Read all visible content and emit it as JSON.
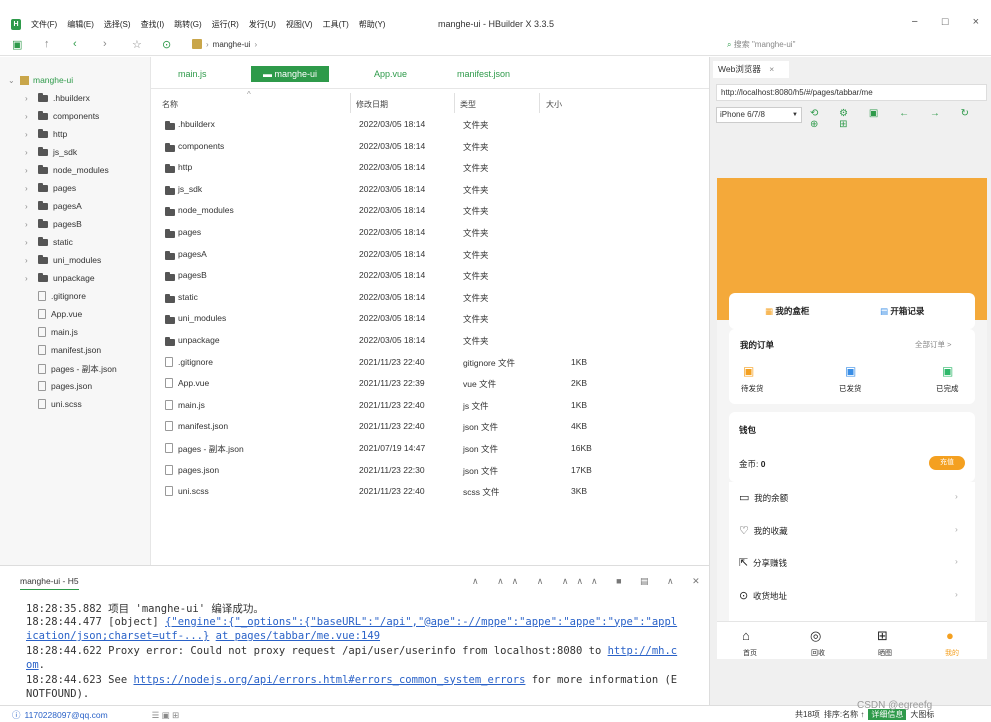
{
  "window": {
    "menu": [
      "文件(F)",
      "编辑(E)",
      "选择(S)",
      "查找(I)",
      "跳转(G)",
      "运行(R)",
      "发行(U)",
      "视图(V)",
      "工具(T)",
      "帮助(Y)"
    ],
    "title": "manghe-ui - HBuilder X 3.3.5",
    "min": "−",
    "max": "□",
    "close": "×"
  },
  "toolbar": {
    "crumb": "manghe-ui",
    "search_placeholder": "搜索 \"manghe-ui\""
  },
  "sidebar": {
    "root": "manghe-ui",
    "items": [
      {
        "label": ".hbuilderx",
        "type": "folder"
      },
      {
        "label": "components",
        "type": "folder"
      },
      {
        "label": "http",
        "type": "folder"
      },
      {
        "label": "js_sdk",
        "type": "folder"
      },
      {
        "label": "node_modules",
        "type": "folder"
      },
      {
        "label": "pages",
        "type": "folder"
      },
      {
        "label": "pagesA",
        "type": "folder"
      },
      {
        "label": "pagesB",
        "type": "folder"
      },
      {
        "label": "static",
        "type": "folder"
      },
      {
        "label": "uni_modules",
        "type": "folder"
      },
      {
        "label": "unpackage",
        "type": "folder"
      },
      {
        "label": ".gitignore",
        "type": "file"
      },
      {
        "label": "App.vue",
        "type": "file"
      },
      {
        "label": "main.js",
        "type": "file"
      },
      {
        "label": "manifest.json",
        "type": "file"
      },
      {
        "label": "pages - 副本.json",
        "type": "file"
      },
      {
        "label": "pages.json",
        "type": "file"
      },
      {
        "label": "uni.scss",
        "type": "file"
      }
    ]
  },
  "tabs": [
    "main.js",
    "manghe-ui",
    "App.vue",
    "manifest.json"
  ],
  "filelist": {
    "headers": [
      "名称",
      "修改日期",
      "类型",
      "大小"
    ],
    "rows": [
      [
        ".hbuilderx",
        "2022/03/05 18:14",
        "文件夹",
        ""
      ],
      [
        "components",
        "2022/03/05 18:14",
        "文件夹",
        ""
      ],
      [
        "http",
        "2022/03/05 18:14",
        "文件夹",
        ""
      ],
      [
        "js_sdk",
        "2022/03/05 18:14",
        "文件夹",
        ""
      ],
      [
        "node_modules",
        "2022/03/05 18:14",
        "文件夹",
        ""
      ],
      [
        "pages",
        "2022/03/05 18:14",
        "文件夹",
        ""
      ],
      [
        "pagesA",
        "2022/03/05 18:14",
        "文件夹",
        ""
      ],
      [
        "pagesB",
        "2022/03/05 18:14",
        "文件夹",
        ""
      ],
      [
        "static",
        "2022/03/05 18:14",
        "文件夹",
        ""
      ],
      [
        "uni_modules",
        "2022/03/05 18:14",
        "文件夹",
        ""
      ],
      [
        "unpackage",
        "2022/03/05 18:14",
        "文件夹",
        ""
      ],
      [
        ".gitignore",
        "2021/11/23 22:40",
        "gitignore 文件",
        "1KB"
      ],
      [
        "App.vue",
        "2021/11/23 22:39",
        "vue 文件",
        "2KB"
      ],
      [
        "main.js",
        "2021/11/23 22:40",
        "js 文件",
        "1KB"
      ],
      [
        "manifest.json",
        "2021/11/23 22:40",
        "json 文件",
        "4KB"
      ],
      [
        "pages - 副本.json",
        "2021/07/19 14:47",
        "json 文件",
        "16KB"
      ],
      [
        "pages.json",
        "2021/11/23 22:30",
        "json 文件",
        "17KB"
      ],
      [
        "uni.scss",
        "2021/11/23 22:40",
        "scss 文件",
        "3KB"
      ]
    ]
  },
  "console": {
    "tab": "manghe-ui - H5",
    "lines": [
      {
        "t": "18:28:35.882 项目 'manghe-ui' 编译成功。"
      },
      {
        "t": "18:28:44.477 [object] ",
        "l": "{\"engine\":{\"_options\":{\"baseURL\":\"/api\",\"@ape\":-//mppe\":\"appe\":\"appe\":\"ype\":\"appl"
      },
      {
        "l": "ication/json;charset=utf-...}",
        "t2": "   ",
        "l2": "at pages/tabbar/me.vue:149"
      },
      {
        "t": "18:28:44.622 Proxy error: Could not proxy request /api/user/userinfo from localhost:8080 to ",
        "l": "http://mh.c"
      },
      {
        "l": "om",
        "t": "."
      },
      {
        "t": "18:28:44.623 See ",
        "l": "https://nodejs.org/api/errors.html#errors_common_system_errors",
        "t2": " for more information (E"
      },
      {
        "t": "NOTFOUND)."
      }
    ]
  },
  "status": {
    "user": "1170228097@qq.com",
    "count": "共18项",
    "sort": "排序:名称 ↑",
    "detail": "详细信息",
    "bigicon": "大图标"
  },
  "browser": {
    "tab": "Web浏览器",
    "url": "http://localhost:8080/h5/#/pages/tabbar/me",
    "device": "iPhone 6/7/8"
  },
  "phone": {
    "box": "我的盒柜",
    "open": "开箱记录",
    "orders": "我的订单",
    "all_orders": "全部订单 >",
    "o1": "待发货",
    "o2": "已发货",
    "o3": "已完成",
    "wallet": "钱包",
    "coins_label": "金币:",
    "coins": "0",
    "recharge": "充值",
    "m1": "我的余额",
    "m2": "我的收藏",
    "m3": "分享赚钱",
    "m4": "收货地址",
    "t1": "首页",
    "t2": "回收",
    "t3": "晒图",
    "t4": "我的"
  },
  "watermark": "CSDN @egreefg"
}
